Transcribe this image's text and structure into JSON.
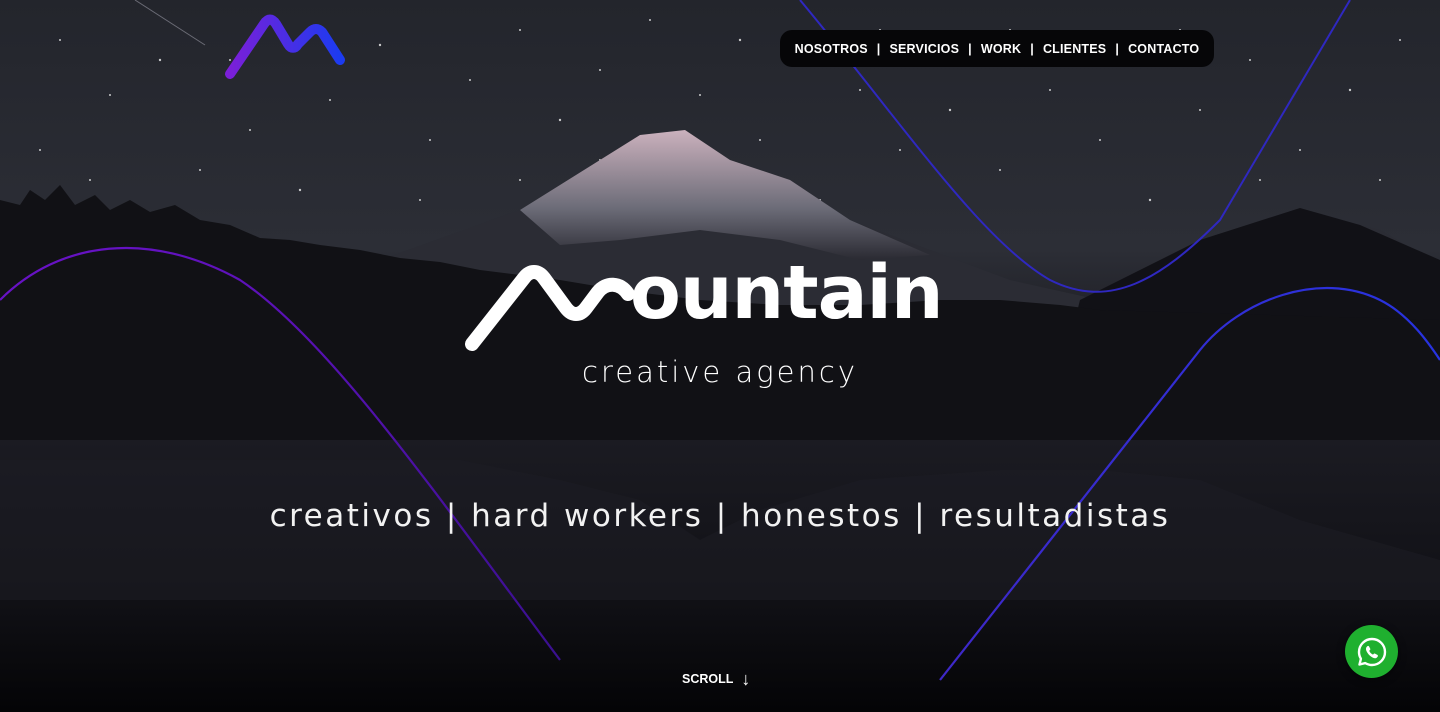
{
  "nav": {
    "items": [
      "NOSOTROS",
      "SERVICIOS",
      "WORK",
      "CLIENTES",
      "CONTACTO"
    ],
    "separator": "|"
  },
  "brand": {
    "word": "ountain",
    "tagline": "creative agency"
  },
  "values_line": "creativos | hard workers | honestos | resultadistas",
  "scroll": {
    "label": "SCROLL",
    "arrow": "↓"
  },
  "icons": {
    "logo": "mountain-logo-icon",
    "whatsapp": "whatsapp-icon",
    "scroll_arrow": "arrow-down-icon"
  },
  "colors": {
    "accent_purple": "#7b1fd8",
    "accent_blue": "#2a2bd9",
    "whatsapp_green": "#1fb02f",
    "nav_bg": "#060608"
  }
}
